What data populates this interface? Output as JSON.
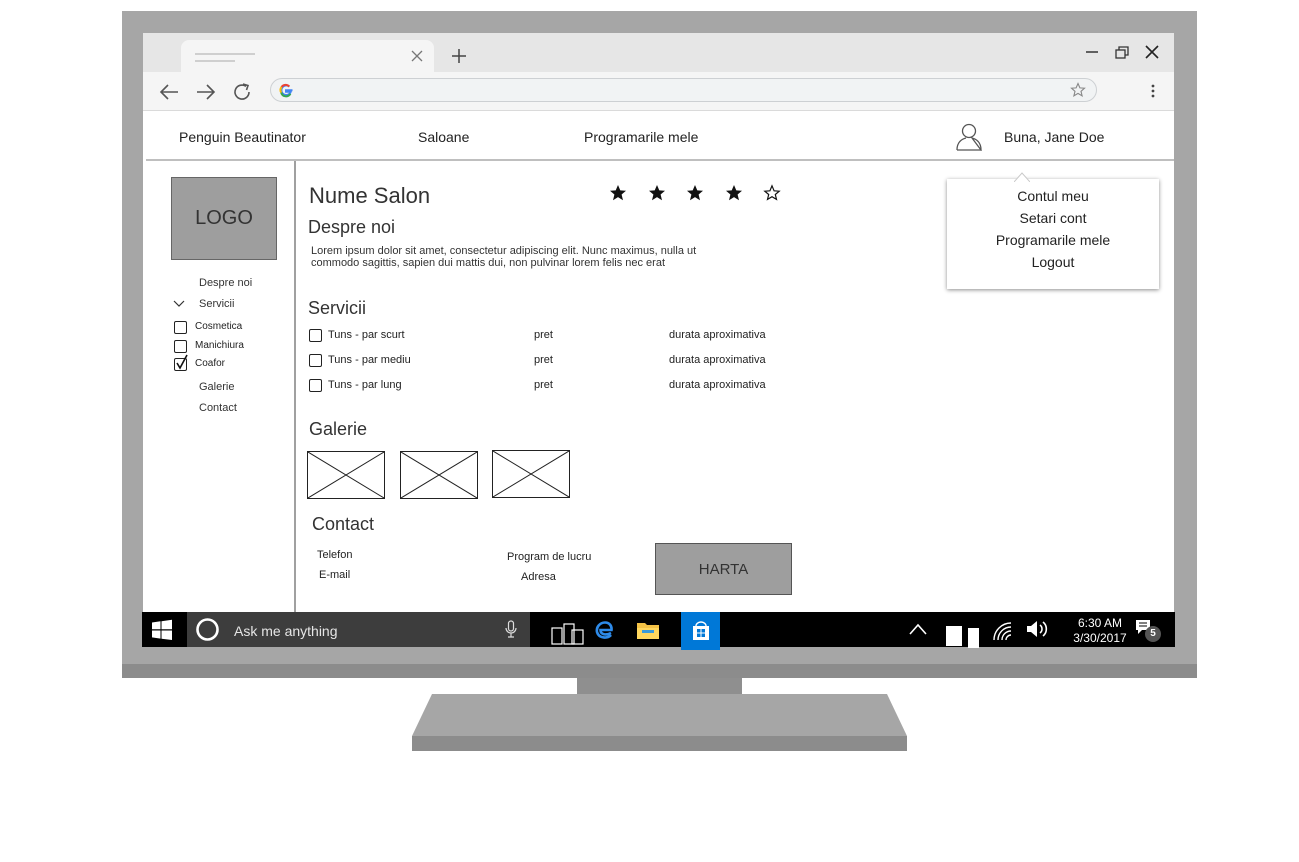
{
  "browser": {
    "omnibox_value": ""
  },
  "app": {
    "nav": {
      "brand": "Penguin Beautinator",
      "saloane": "Saloane",
      "programari": "Programarile mele",
      "greeting": "Buna, Jane Doe"
    },
    "dropdown": {
      "items": [
        "Contul meu",
        "Setari cont",
        "Programarile mele",
        "Logout"
      ]
    },
    "sidebar": {
      "logo": "LOGO",
      "links": {
        "despre": "Despre noi",
        "servicii": "Servicii",
        "galerie": "Galerie",
        "contact": "Contact"
      },
      "categories": [
        {
          "label": "Cosmetica",
          "checked": false
        },
        {
          "label": "Manichiura",
          "checked": false
        },
        {
          "label": "Coafor",
          "checked": true
        }
      ]
    },
    "salon": {
      "name": "Nume Salon",
      "rating": {
        "value": 4,
        "max": 5
      },
      "about_title": "Despre noi",
      "about_text": "Lorem ipsum dolor sit amet, consectetur adipiscing elit. Nunc maximus, nulla ut commodo sagittis, sapien dui mattis dui, non pulvinar lorem felis nec erat",
      "services_title": "Servicii",
      "services": [
        {
          "name": "Tuns - par scurt",
          "price": "pret",
          "duration": "durata aproximativa",
          "checked": false
        },
        {
          "name": "Tuns - par mediu",
          "price": "pret",
          "duration": "durata aproximativa",
          "checked": false
        },
        {
          "name": "Tuns - par lung",
          "price": "pret",
          "duration": "durata aproximativa",
          "checked": false
        }
      ],
      "gallery_title": "Galerie",
      "gallery_count": 3,
      "contact_title": "Contact",
      "contact": {
        "phone": "Telefon",
        "email": "E-mail",
        "schedule": "Program de lucru",
        "address": "Adresa",
        "map": "HARTA"
      }
    }
  },
  "taskbar": {
    "search_placeholder": "Ask me anything",
    "time": "6:30 AM",
    "date": "3/30/2017",
    "notifications": "5",
    "store_color": "#0078d7"
  }
}
